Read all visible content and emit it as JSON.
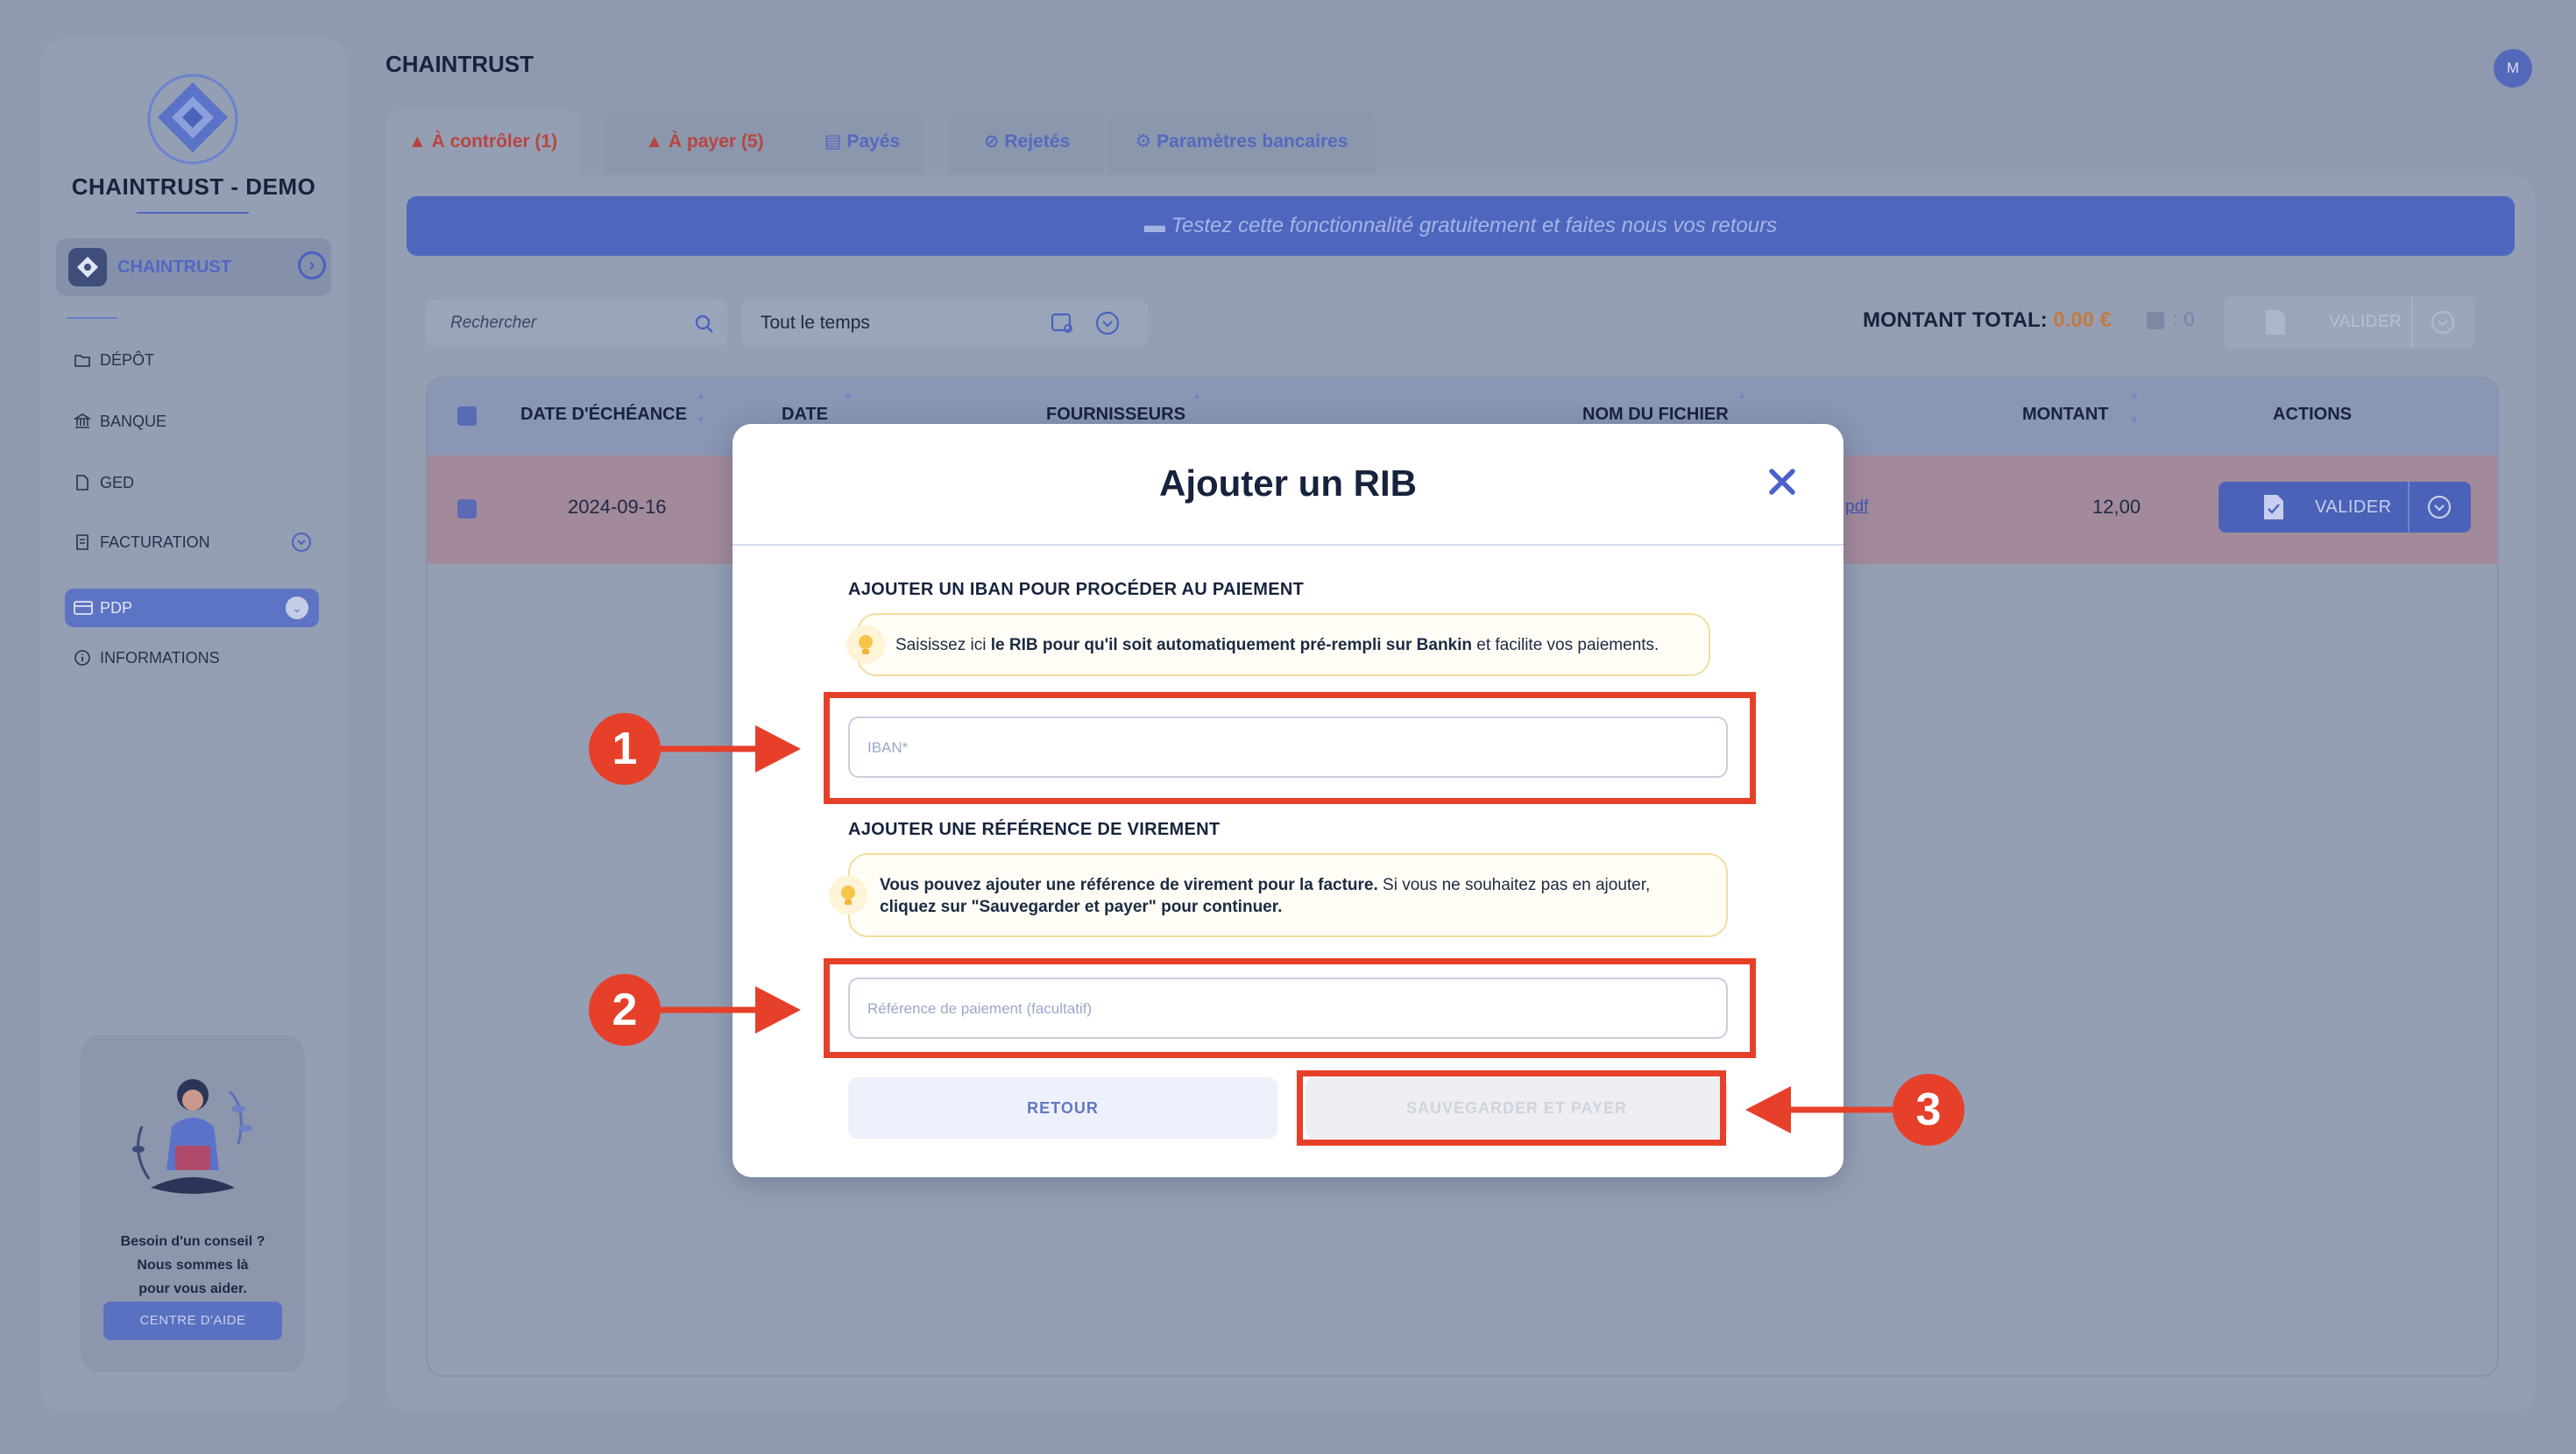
{
  "sidebar": {
    "org_name": "CHAINTRUST - DEMO",
    "company_label": "CHAINTRUST",
    "nav": [
      {
        "label": "DÉPÔT",
        "icon": "folder-upload-icon"
      },
      {
        "label": "BANQUE",
        "icon": "bank-icon"
      },
      {
        "label": "GED",
        "icon": "document-icon"
      },
      {
        "label": "FACTURATION",
        "icon": "invoice-icon"
      },
      {
        "label": "PDP",
        "icon": "card-icon"
      },
      {
        "label": "INFORMATIONS",
        "icon": "info-icon"
      }
    ],
    "help": {
      "line1": "Besoin d'un conseil ?",
      "line2": "Nous sommes là",
      "line3": "pour vous aider.",
      "button": "CENTRE D'AIDE"
    }
  },
  "header": {
    "title": "CHAINTRUST",
    "avatar_initial": "M"
  },
  "tabs": [
    {
      "label": "À contrôler (1)",
      "icon": "warning-icon",
      "active": true
    },
    {
      "label": "À payer (5)",
      "icon": "warning-icon",
      "active": false
    },
    {
      "label": "Payés",
      "icon": "card-icon",
      "active": false
    },
    {
      "label": "Rejetés",
      "icon": "ban-icon",
      "active": false
    },
    {
      "label": "Paramètres bancaires",
      "icon": "gear-icon",
      "active": false
    }
  ],
  "banner": {
    "text": "Testez cette fonctionnalité gratuitement et faites nous vos retours"
  },
  "toolbar": {
    "search_placeholder": "Rechercher",
    "period_value": "Tout le temps",
    "total_label": "MONTANT TOTAL:",
    "total_value": "0.00 €",
    "selected_count": ": 0",
    "valider_label": "VALIDER"
  },
  "table": {
    "headers": [
      "DATE D'ÉCHÉANCE",
      "DATE",
      "FOURNISSEURS",
      "NOM DU FICHIER",
      "MONTANT",
      "ACTIONS"
    ],
    "rows": [
      {
        "due_date": "2024-09-16",
        "file_suffix": "pdf",
        "amount": "12,00",
        "action": "VALIDER"
      }
    ]
  },
  "modal": {
    "title": "Ajouter un RIB",
    "iban_section": "AJOUTER UN IBAN POUR PROCÉDER AU PAIEMENT",
    "iban_hint_pre": "Saisissez ici ",
    "iban_hint_bold": "le RIB pour qu'il soit automatiquement pré-rempli sur Bankin",
    "iban_hint_post": " et facilite vos paiements.",
    "iban_placeholder": "IBAN*",
    "ref_section": "AJOUTER UNE RÉFÉRENCE DE VIREMENT",
    "ref_hint_bold1": "Vous pouvez ajouter une référence de virement pour la facture.",
    "ref_hint_mid": " Si vous ne souhaitez pas en ajouter,",
    "ref_hint_bold2": "cliquez sur \"Sauvegarder et payer\" pour continuer.",
    "ref_placeholder": "Référence de paiement (facultatif)",
    "back_button": "RETOUR",
    "save_button": "SAUVEGARDER ET PAYER"
  },
  "annotations": {
    "step1": "1",
    "step2": "2",
    "step3": "3",
    "color": "#e6402a"
  }
}
